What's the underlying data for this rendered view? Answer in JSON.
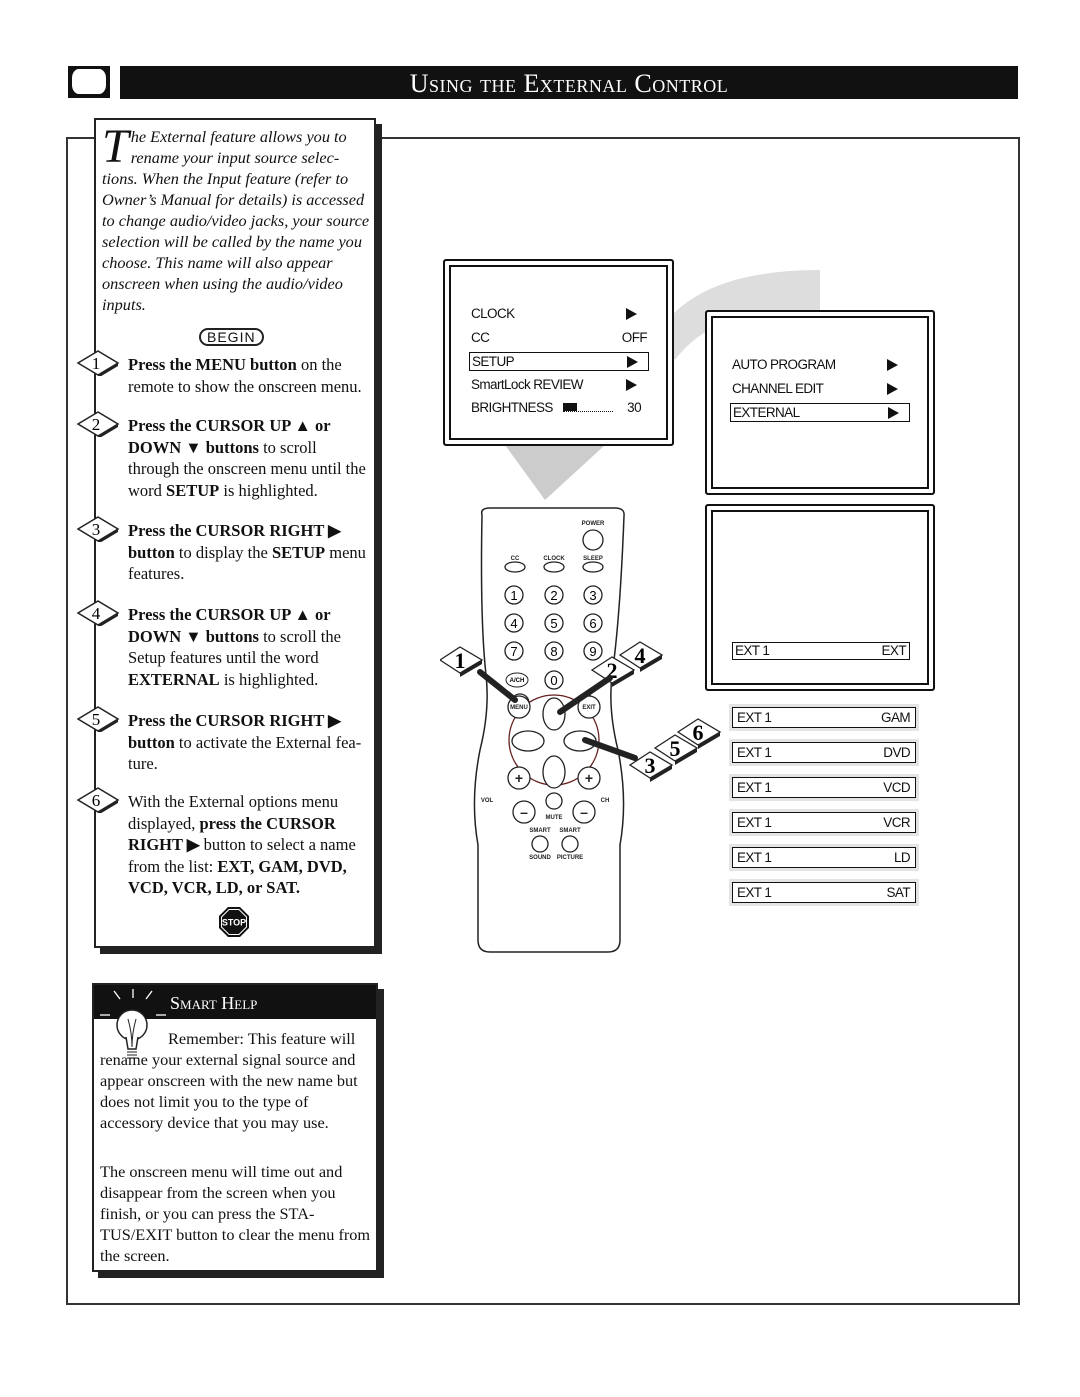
{
  "header": {
    "title": "Using the External Control"
  },
  "intro": {
    "dropcap": "T",
    "text": "he External feature allows you to rename your input source selec- tions. When the Input feature (refer to Owner’s Manual for details) is accessed to change audio/video jacks, your source selection will be called by the name you choose. This name will also appear onscreen when using the audio/video inputs.",
    "begin_label": "BEGIN"
  },
  "steps": [
    {
      "number": "1",
      "segments": [
        {
          "t": "Press the MENU button",
          "b": true
        },
        {
          "t": " on the remote to show the onscreen menu.",
          "b": false
        }
      ]
    },
    {
      "number": "2",
      "segments": [
        {
          "t": "Press the CURSOR UP ▲ or DOWN ▼ buttons",
          "b": true
        },
        {
          "t": " to scroll through the onscreen menu until the word ",
          "b": false
        },
        {
          "t": "SETUP",
          "b": true
        },
        {
          "t": " is highlighted.",
          "b": false
        }
      ]
    },
    {
      "number": "3",
      "segments": [
        {
          "t": "Press the CURSOR RIGHT ▶ button",
          "b": true
        },
        {
          "t": " to display the ",
          "b": false
        },
        {
          "t": "SETUP",
          "b": true
        },
        {
          "t": " menu features.",
          "b": false
        }
      ]
    },
    {
      "number": "4",
      "segments": [
        {
          "t": "Press the CURSOR UP ▲ or DOWN ▼ buttons",
          "b": true
        },
        {
          "t": " to scroll the Setup features until the word ",
          "b": false
        },
        {
          "t": "EXTERNAL",
          "b": true
        },
        {
          "t": " is highlighted.",
          "b": false
        }
      ]
    },
    {
      "number": "5",
      "segments": [
        {
          "t": "Press the CURSOR RIGHT ▶ button",
          "b": true
        },
        {
          "t": " to activate the External fea- ture.",
          "b": false
        }
      ]
    },
    {
      "number": "6",
      "segments": [
        {
          "t": "With the External options menu displayed, ",
          "b": false
        },
        {
          "t": "press the CURSOR RIGHT ▶",
          "b": true
        },
        {
          "t": " button to select a name from the list: ",
          "b": false
        },
        {
          "t": "EXT, GAM, DVD, VCD, VCR, LD, or SAT.",
          "b": true
        }
      ]
    }
  ],
  "stop_label": "STOP",
  "smart_help": {
    "title": "Smart Help",
    "p1": "Remember: This feature will rename your external signal source and appear onscreen with the new name but does not limit you to the type of accessory device that you may use.",
    "p2": "The onscreen menu will time out and disappear from the screen when you finish, or you can press the STA- TUS/EXIT button to clear the menu from the screen."
  },
  "screen1": {
    "items": [
      {
        "label": "CLOCK",
        "value": "▶",
        "highlighted": false
      },
      {
        "label": "CC",
        "value": "OFF",
        "highlighted": false
      },
      {
        "label": "SETUP",
        "value": "▶",
        "highlighted": true
      },
      {
        "label": "SmartLock REVIEW",
        "value": "▶",
        "highlighted": false
      },
      {
        "label": "BRIGHTNESS",
        "value": "30",
        "highlighted": false
      }
    ],
    "brightness_level": 0.5
  },
  "screen2": {
    "items": [
      {
        "label": "AUTO PROGRAM",
        "value": "▶",
        "highlighted": false
      },
      {
        "label": "CHANNEL EDIT",
        "value": "▶",
        "highlighted": false
      },
      {
        "label": "EXTERNAL",
        "value": "▶",
        "highlighted": true
      }
    ]
  },
  "screen3": {
    "label": "EXT 1",
    "value": "EXT"
  },
  "ext_options": [
    {
      "label": "EXT 1",
      "value": "GAM"
    },
    {
      "label": "EXT 1",
      "value": "DVD"
    },
    {
      "label": "EXT 1",
      "value": "VCD"
    },
    {
      "label": "EXT 1",
      "value": "VCR"
    },
    {
      "label": "EXT 1",
      "value": "LD"
    },
    {
      "label": "EXT 1",
      "value": "SAT"
    }
  ],
  "remote": {
    "power": "POWER",
    "cc": "CC",
    "clock": "CLOCK",
    "sleep": "SLEEP",
    "digits": [
      "1",
      "2",
      "3",
      "4",
      "5",
      "6",
      "7",
      "8",
      "9",
      "0"
    ],
    "ach": "A/CH",
    "menu": "MENU",
    "exit": "EXIT",
    "vol": "VOL",
    "ch": "CH",
    "plus": "+",
    "minus": "–",
    "mute": "MUTE",
    "smart1": "SMART",
    "smart2": "SMART",
    "sound": "SOUND",
    "picture": "PICTURE",
    "callouts": [
      "1",
      "2",
      "4",
      "3",
      "5",
      "6"
    ]
  }
}
